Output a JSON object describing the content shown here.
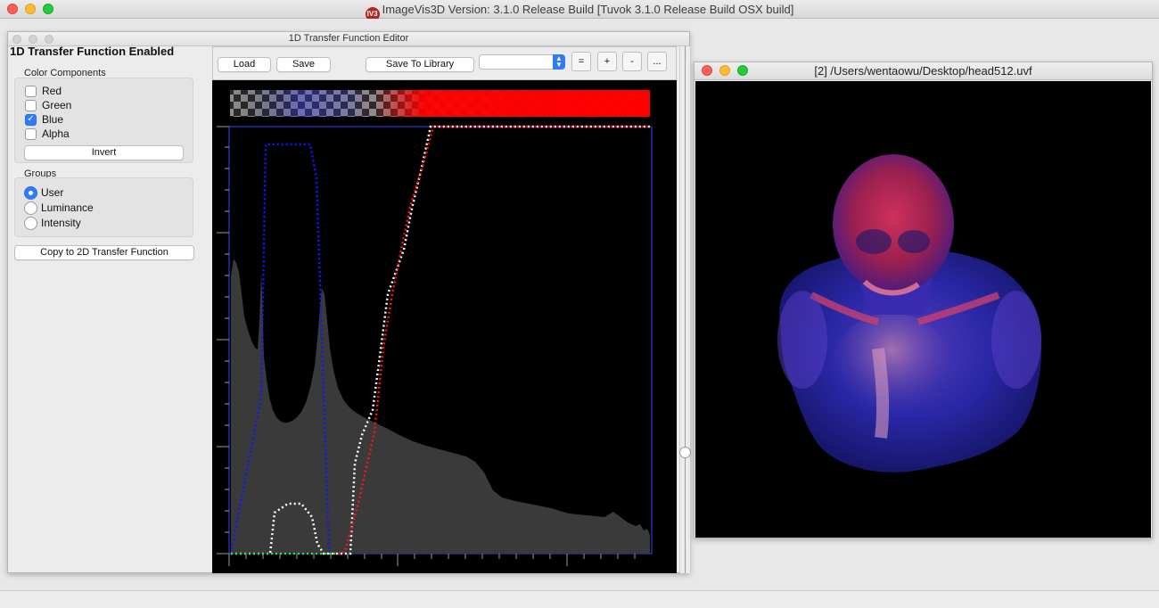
{
  "app": {
    "title": "ImageVis3D Version: 3.1.0 Release Build [Tuvok 3.1.0 Release Build OSX build]",
    "icon_text": "IV3",
    "icon_name": "imagevis3d-app-icon"
  },
  "tf_editor": {
    "window_title": "1D Transfer Function Editor",
    "status_label": "1D Transfer Function Enabled",
    "color_components": {
      "title": "Color Components",
      "items": [
        {
          "label": "Red",
          "checked": false
        },
        {
          "label": "Green",
          "checked": false
        },
        {
          "label": "Blue",
          "checked": true
        },
        {
          "label": "Alpha",
          "checked": false
        }
      ],
      "invert_label": "Invert"
    },
    "groups": {
      "title": "Groups",
      "items": [
        {
          "label": "User",
          "selected": true
        },
        {
          "label": "Luminance",
          "selected": false
        },
        {
          "label": "Intensity",
          "selected": false
        }
      ]
    },
    "copy_button_label": "Copy to 2D Transfer Function",
    "toolbar": {
      "load_label": "Load",
      "save_label": "Save",
      "save_library_label": "Save To Library",
      "library_value": "",
      "equal_label": "=",
      "plus_label": "+",
      "minus_label": "-",
      "more_label": "..."
    }
  },
  "render_window": {
    "title": "[2] /Users/wentaowu/Desktop/head512.uvf"
  },
  "colors": {
    "accent": "#2f7cf6",
    "histogram": "#3a3a3a",
    "curve_blue": "#1010ff",
    "curve_red": "#ff1010",
    "curve_alpha": "#ffffff"
  }
}
